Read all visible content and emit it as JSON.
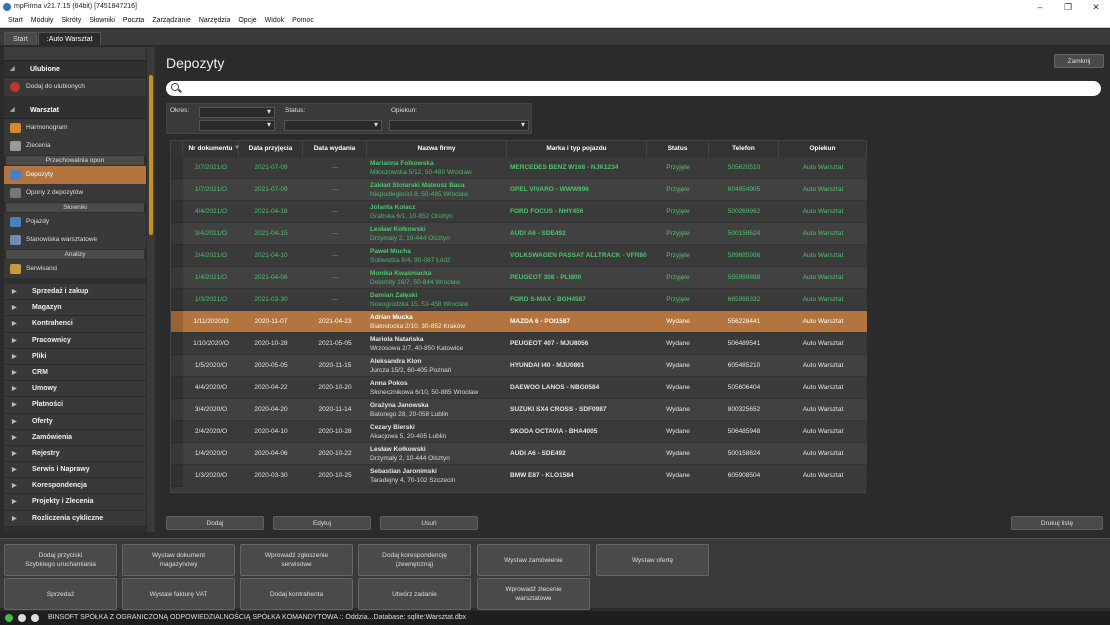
{
  "window": {
    "title": "mpFirma v21.7.15 (64bit) [7451847216]"
  },
  "menu": [
    "Start",
    "Moduły",
    "Skróty",
    "Słowniki",
    "Poczta",
    "Zarządzanie",
    "Narzędzia",
    "Opcje",
    "Widok",
    "Pomoc"
  ],
  "tabs": [
    "Start",
    ":Auto Warsztat"
  ],
  "sidebar": {
    "favorites_header": "Ulubione",
    "add_favorite": "Dodaj do ulubionych",
    "workshop_header": "Warsztat",
    "items_a": [
      "Harmonogram",
      "Zlecenia"
    ],
    "sub_tires": "Przechowalnia opon",
    "deposits": "Depozyty",
    "tires_from_deposits": "Opony z depozytów",
    "sub_dicts": "Słowniki",
    "items_b": [
      "Pojazdy",
      "Stanowiska warsztatowe"
    ],
    "sub_analysis": "Analizy",
    "services": "Serwisanci",
    "groups": [
      "Sprzedaż i zakup",
      "Magazyn",
      "Kontrahenci",
      "Pracownicy",
      "Pliki",
      "CRM",
      "Umowy",
      "Płatności",
      "Oferty",
      "Zamówienia",
      "Rejestry",
      "Serwis i Naprawy",
      "Korespondencja",
      "Projekty i Zlecenia",
      "Rozliczenia cykliczne"
    ]
  },
  "page": {
    "title": "Depozyty",
    "close_label": "Zamknij",
    "filters": {
      "period_label": "Okres:",
      "status_label": "Status:",
      "keeper_label": "Opiekun:"
    },
    "columns": [
      "Nr dokumentu",
      "Data przyjęcia",
      "Data wydania",
      "Nazwa firmy",
      "Marka i typ pojazdu",
      "Status",
      "Telefon",
      "Opiekun"
    ],
    "rows": [
      {
        "nr": "2/7/2021/O",
        "date_in": "2021-07-09",
        "date_out": "---",
        "name": "Marianna Folkowska",
        "addr": "Miłoszowska 5/12, 50-480 Wrocław",
        "car": "MERCEDES BENZ W168 - NJK1234",
        "status": "Przyjęte",
        "phone": "505620510",
        "keeper": "Auto Warsztat",
        "state": "received"
      },
      {
        "nr": "1/7/2021/O",
        "date_in": "2021-07-09",
        "date_out": "---",
        "name": "Zakład Stolarski Mateusz Baca",
        "addr": "Niepodległości 8, 50-485 Wrocław",
        "car": "OPEL VIVARO - WWW896",
        "status": "Przyjęte",
        "phone": "604854905",
        "keeper": "Auto Warsztat",
        "state": "received"
      },
      {
        "nr": "4/4/2021/O",
        "date_in": "2021-04-18",
        "date_out": "---",
        "name": "Jolanta Kolacz",
        "addr": "Grabska 6/1, 10-852 Olsztyn",
        "car": "FORD FOCUS - NHY456",
        "status": "Przyjęte",
        "phone": "500269962",
        "keeper": "Auto Warsztat",
        "state": "received"
      },
      {
        "nr": "3/4/2021/O",
        "date_in": "2021-04-15",
        "date_out": "---",
        "name": "Lesław Kołkowski",
        "addr": "Drzymały 2, 10-444 Olsztyn",
        "car": "AUDI A6 - SDE492",
        "status": "Przyjęte",
        "phone": "500158624",
        "keeper": "Auto Warsztat",
        "state": "received"
      },
      {
        "nr": "2/4/2021/O",
        "date_in": "2021-04-10",
        "date_out": "---",
        "name": "Paweł Mucha",
        "addr": "Soliwodza 6/4, 90-087 Łódź",
        "car": "VOLKSWAGEN PASSAT ALLTRACK - VFR80",
        "status": "Przyjęte",
        "phone": "589685986",
        "keeper": "Auto Warsztat",
        "state": "received"
      },
      {
        "nr": "1/4/2021/O",
        "date_in": "2021-04-06",
        "date_out": "---",
        "name": "Monika Kwaśniacka",
        "addr": "Dolomity 16/7, 50-844 Wrocław",
        "car": "PEUGEOT 308 - PLI800",
        "status": "Przyjęte",
        "phone": "555999888",
        "keeper": "Auto Warsztat",
        "state": "received"
      },
      {
        "nr": "1/3/2021/O",
        "date_in": "2021-03-30",
        "date_out": "---",
        "name": "Damian Załęski",
        "addr": "Noeogrodzka 15, 53-458 Wrocław",
        "car": "FORD S-MAX - BGH4587",
        "status": "Przyjęte",
        "phone": "665998332",
        "keeper": "Auto Warsztat",
        "state": "received"
      },
      {
        "nr": "1/11/2020/O",
        "date_in": "2020-11-07",
        "date_out": "2021-04-23",
        "name": "Adrian Mucka",
        "addr": "Białostocka 2/10, 30-852 Kraków",
        "car": "MAZDA 6 - POI1587",
        "status": "Wydane",
        "phone": "556228441",
        "keeper": "Auto Warsztat",
        "state": "selected"
      },
      {
        "nr": "1/10/2020/O",
        "date_in": "2020-10-28",
        "date_out": "2021-05-05",
        "name": "Mariola Natańska",
        "addr": "Wrzosowa 2/7, 40-850 Katowice",
        "car": "PEUGEOT 407 - MJU8056",
        "status": "Wydane",
        "phone": "506489541",
        "keeper": "Auto Warsztat",
        "state": "issued"
      },
      {
        "nr": "1/5/2020/O",
        "date_in": "2020-05-05",
        "date_out": "2020-11-15",
        "name": "Aleksandra Klon",
        "addr": "Jurcza 15/2, 60-405 Poznań",
        "car": "HYUNDAI I40 - MJU0861",
        "status": "Wydane",
        "phone": "605485210",
        "keeper": "Auto Warsztat",
        "state": "issued"
      },
      {
        "nr": "4/4/2020/O",
        "date_in": "2020-04-22",
        "date_out": "2020-10-20",
        "name": "Anna Pokos",
        "addr": "Słonecznikowa 6/10, 50-885 Wrocław",
        "car": "DAEWOO LANOS - NBG0584",
        "status": "Wydane",
        "phone": "505606404",
        "keeper": "Auto Warsztat",
        "state": "issued"
      },
      {
        "nr": "3/4/2020/O",
        "date_in": "2020-04-20",
        "date_out": "2020-11-14",
        "name": "Grażyna Janowska",
        "addr": "Batorego 28, 20-058 Lublin",
        "car": "SUZUKI SX4 CROSS - SDF0987",
        "status": "Wydane",
        "phone": "800325652",
        "keeper": "Auto Warsztat",
        "state": "issued"
      },
      {
        "nr": "2/4/2020/O",
        "date_in": "2020-04-10",
        "date_out": "2020-10-28",
        "name": "Cezary Bierski",
        "addr": "Akacjowa 5, 20-405 Lublin",
        "car": "SKODA OCTAVIA - BHA4005",
        "status": "Wydane",
        "phone": "506485948",
        "keeper": "Auto Warsztat",
        "state": "issued"
      },
      {
        "nr": "1/4/2020/O",
        "date_in": "2020-04-06",
        "date_out": "2020-10-22",
        "name": "Lesław Kołkowski",
        "addr": "Drzymały 2, 10-444 Olsztyn",
        "car": "AUDI A6 - SDE492",
        "status": "Wydane",
        "phone": "500158624",
        "keeper": "Auto Warsztat",
        "state": "issued"
      },
      {
        "nr": "1/3/2020/O",
        "date_in": "2020-03-30",
        "date_out": "2020-10-25",
        "name": "Sebastian Jaronimski",
        "addr": "Taradejny 4, 70-102 Szczecin",
        "car": "BMW E87 - KLO1584",
        "status": "Wydane",
        "phone": "605908504",
        "keeper": "Auto Warsztat",
        "state": "issued"
      }
    ],
    "buttons": {
      "add": "Dodaj",
      "edit": "Edytuj",
      "delete": "Usuń",
      "print": "Drukuj listę"
    }
  },
  "actions_row1": [
    "Dodaj przyciski\nSzybkiego uruchamiania",
    "Wystaw dokument\nmagazynowy",
    "Wprowadź zgłoszenie\nserwisowe",
    "Dodaj korespondencję\n(zewnętrzną)",
    "Wystaw zamówienie",
    "Wystaw ofertę"
  ],
  "actions_row2": [
    "Sprzedaż",
    "Wystaw fakturę VAT",
    "Dodaj kontrahenta",
    "Utwórz zadanie",
    "Wprowadź zlecenie\nwarsztatowe"
  ],
  "statusbar": "BINSOFT SPÓŁKA Z OGRANICZONĄ ODPOWIEDZIALNOŚCIĄ SPÓŁKA KOMANDYTOWA :: Oddzia...Database: sqlite:Warsztat.dbx",
  "colors": {
    "accent": "#b4743d",
    "received": "#4cc46c",
    "scrollbar": "#c8911e"
  }
}
